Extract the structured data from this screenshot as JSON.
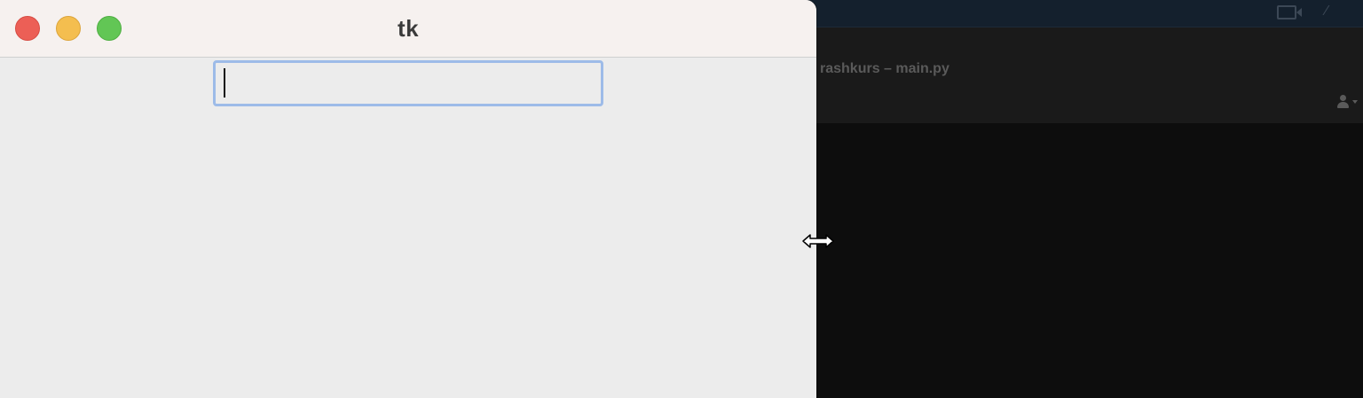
{
  "background_app": {
    "window_title": "rashkurs – main.py",
    "icons": [
      "video-camera-icon",
      "mute-icon",
      "user-icon"
    ]
  },
  "tk_window": {
    "title": "tk",
    "entry": {
      "value": "",
      "placeholder": ""
    },
    "traffic_lights": [
      "close",
      "minimize",
      "zoom"
    ]
  },
  "colors": {
    "close": "#ec5f56",
    "minimize": "#f4be4f",
    "zoom": "#62c655",
    "focus_ring": "#9dbbe8",
    "window_bg": "#ececec",
    "titlebar_bg": "#f6f1ef"
  },
  "cursor": "horizontal-resize-cursor"
}
